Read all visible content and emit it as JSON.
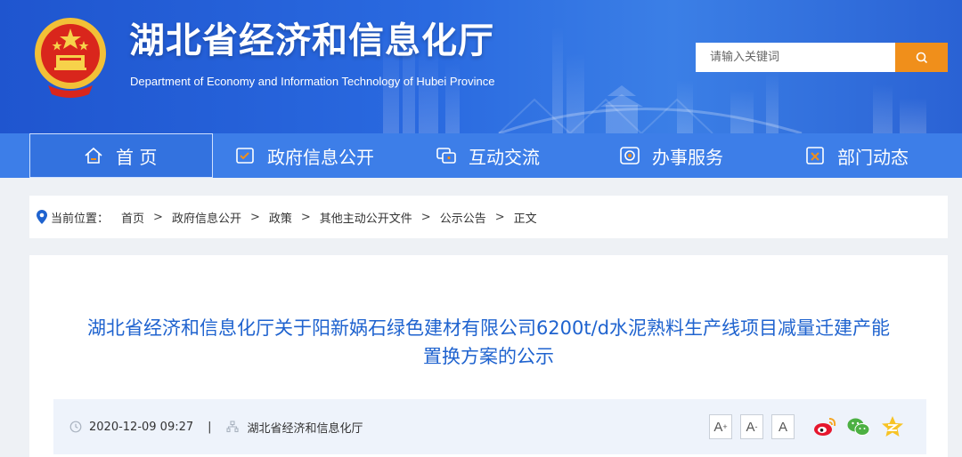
{
  "header": {
    "title": "湖北省经济和信息化厅",
    "subtitle": "Department of Economy and Information Technology of Hubei Province",
    "search_placeholder": "请输入关键词",
    "colors": {
      "primary": "#2a6ae0",
      "accent": "#f08f1b"
    }
  },
  "nav": {
    "items": [
      {
        "label": "首 页",
        "icon": "home-icon",
        "active": true
      },
      {
        "label": "政府信息公开",
        "icon": "document-icon"
      },
      {
        "label": "互动交流",
        "icon": "chat-icon"
      },
      {
        "label": "办事服务",
        "icon": "service-icon"
      },
      {
        "label": "部门动态",
        "icon": "news-icon"
      }
    ]
  },
  "breadcrumb": {
    "label": "当前位置：",
    "items": [
      "首页",
      "政府信息公开",
      "政策",
      "其他主动公开文件",
      "公示公告",
      "正文"
    ],
    "separator": ">"
  },
  "article": {
    "title_line1": "湖北省经济和信息化厅关于阳新娲石绿色建材有限公司6200t/d水泥熟料生产线项目减量迁建产能",
    "title_line2": "置换方案的公示",
    "date": "2020-12-09 09:27",
    "divider": "|",
    "source": "湖北省经济和信息化厅",
    "font_buttons": [
      "A",
      "A",
      "A"
    ],
    "font_button_marks": [
      "+",
      "-"
    ],
    "share_icons": [
      "weibo-icon",
      "wechat-icon",
      "qzone-icon"
    ]
  }
}
